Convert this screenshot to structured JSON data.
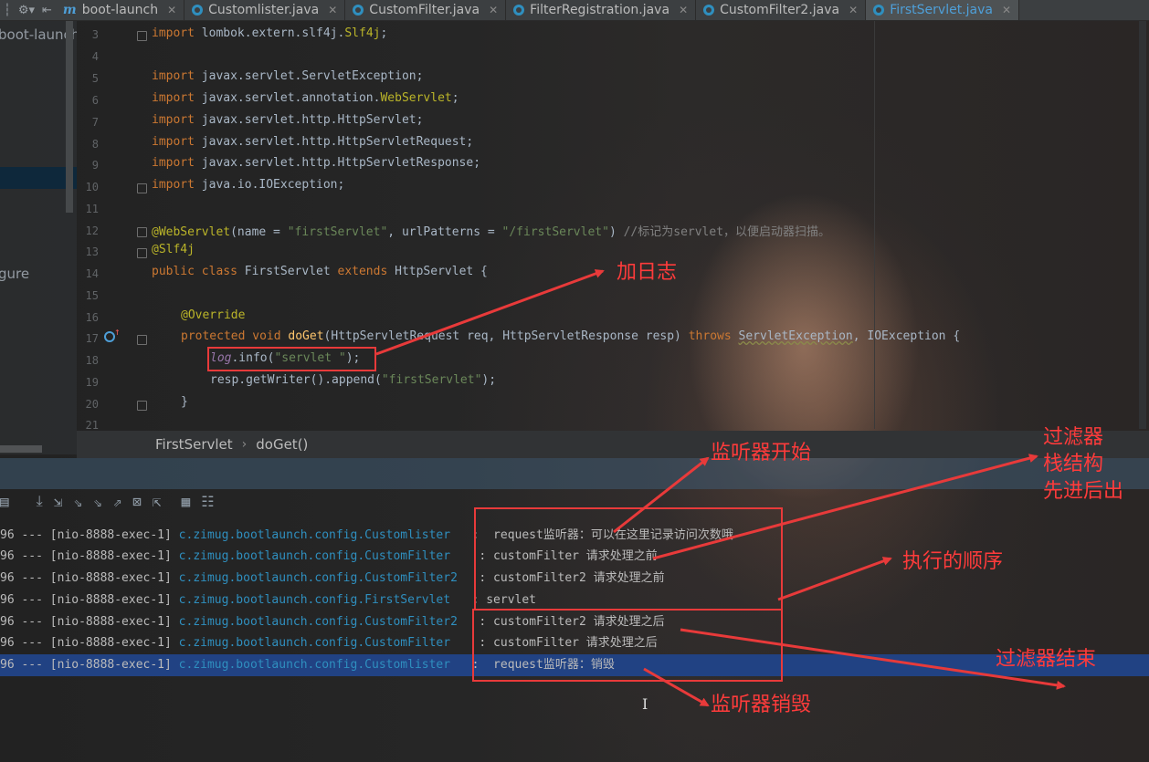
{
  "tabs": [
    {
      "label": "boot-launch",
      "icon": "maven-module-icon",
      "active": false
    },
    {
      "label": "Customlister.java",
      "icon": "java-class-icon",
      "active": false
    },
    {
      "label": "CustomFilter.java",
      "icon": "java-class-icon",
      "active": false
    },
    {
      "label": "FilterRegistration.java",
      "icon": "java-class-icon",
      "active": false
    },
    {
      "label": "CustomFilter2.java",
      "icon": "java-class-icon",
      "active": false
    },
    {
      "label": "FirstServlet.java",
      "icon": "java-class-icon",
      "active": true
    }
  ],
  "left_panel": {
    "project": "boot-launch",
    "item": "gure"
  },
  "editor": {
    "line_numbers": [
      "3",
      "4",
      "5",
      "6",
      "7",
      "8",
      "9",
      "10",
      "11",
      "12",
      "13",
      "14",
      "15",
      "16",
      "17",
      "18",
      "19",
      "20",
      "21"
    ],
    "lines": {
      "l3": {
        "kw": "import",
        "rest": " lombok.extern.slf4j.",
        "ann": "Slf4j",
        "end": ";"
      },
      "l5": {
        "kw": "import",
        "rest": " javax.servlet.ServletException;"
      },
      "l6": {
        "kw": "import",
        "rest": " javax.servlet.annotation.",
        "ann": "WebServlet",
        "end": ";"
      },
      "l7": {
        "kw": "import",
        "rest": " javax.servlet.http.HttpServlet;"
      },
      "l8": {
        "kw": "import",
        "rest": " javax.servlet.http.HttpServletRequest;"
      },
      "l9": {
        "kw": "import",
        "rest": " javax.servlet.http.HttpServletResponse;"
      },
      "l10": {
        "kw": "import",
        "rest": " java.io.IOException;"
      },
      "l12": {
        "ann": "@WebServlet",
        "p1": "(name = ",
        "s1": "\"firstServlet\"",
        "p2": ", urlPatterns = ",
        "s2": "\"/firstServlet\"",
        "p3": ") ",
        "cm": "//标记为servlet，以便启动器扫描。"
      },
      "l13": {
        "ann": "@Slf4j"
      },
      "l14": {
        "kw1": "public class",
        "name": " FirstServlet ",
        "kw2": "extends",
        "rest": " HttpServlet {"
      },
      "l16": {
        "ann": "@Override"
      },
      "l17": {
        "kw1": "protected void",
        "fn": " doGet",
        "rest": "(HttpServletRequest req, HttpServletResponse resp) ",
        "kw2": "throws",
        "sp": " ",
        "ex1": "ServletException",
        "end": ", IOException {"
      },
      "l18": {
        "it": "log",
        "mid": ".info(",
        "s": "\"servlet \"",
        "end": ");"
      },
      "l19": {
        "pre": "resp.getWriter().append(",
        "s": "\"firstServlet\"",
        "end": ");"
      },
      "l20": {
        "text": "}"
      }
    }
  },
  "breadcrumb": {
    "class": "FirstServlet",
    "method": "doGet()"
  },
  "console": {
    "lines": [
      {
        "prefix": "96 --- [nio-8888-exec-1] ",
        "cls": "c.zimug.bootlaunch.config.Customlister",
        "msg": "   :  request监听器：可以在这里记录访问次数哦"
      },
      {
        "prefix": "96 --- [nio-8888-exec-1] ",
        "cls": "c.zimug.bootlaunch.config.CustomFilter",
        "msg": "    : customFilter 请求处理之前"
      },
      {
        "prefix": "96 --- [nio-8888-exec-1] ",
        "cls": "c.zimug.bootlaunch.config.CustomFilter2",
        "msg": "   : customFilter2 请求处理之前"
      },
      {
        "prefix": "96 --- [nio-8888-exec-1] ",
        "cls": "c.zimug.bootlaunch.config.FirstServlet",
        "msg": "   : servlet"
      },
      {
        "prefix": "96 --- [nio-8888-exec-1] ",
        "cls": "c.zimug.bootlaunch.config.CustomFilter2",
        "msg": "   : customFilter2 请求处理之后"
      },
      {
        "prefix": "96 --- [nio-8888-exec-1] ",
        "cls": "c.zimug.bootlaunch.config.CustomFilter",
        "msg": "    : customFilter 请求处理之后"
      },
      {
        "prefix": "96 --- [nio-8888-exec-1] ",
        "cls": "c.zimug.bootlaunch.config.Customlister",
        "msg": "   :  request监听器：销毁"
      }
    ]
  },
  "annotations": {
    "add_log": "加日志",
    "listener_start": "监听器开始",
    "filter_stack_1": "过滤器",
    "filter_stack_2": "栈结构",
    "filter_stack_3": "先进后出",
    "exec_order": "执行的顺序",
    "filter_end": "过滤器结束",
    "listener_destroy": "监听器销毁"
  },
  "colors": {
    "annotation": "#ff3b3b",
    "keyword": "#cc7832",
    "annotation_code": "#bbb529",
    "string": "#6a8759",
    "class_link": "#2f8fbf"
  }
}
